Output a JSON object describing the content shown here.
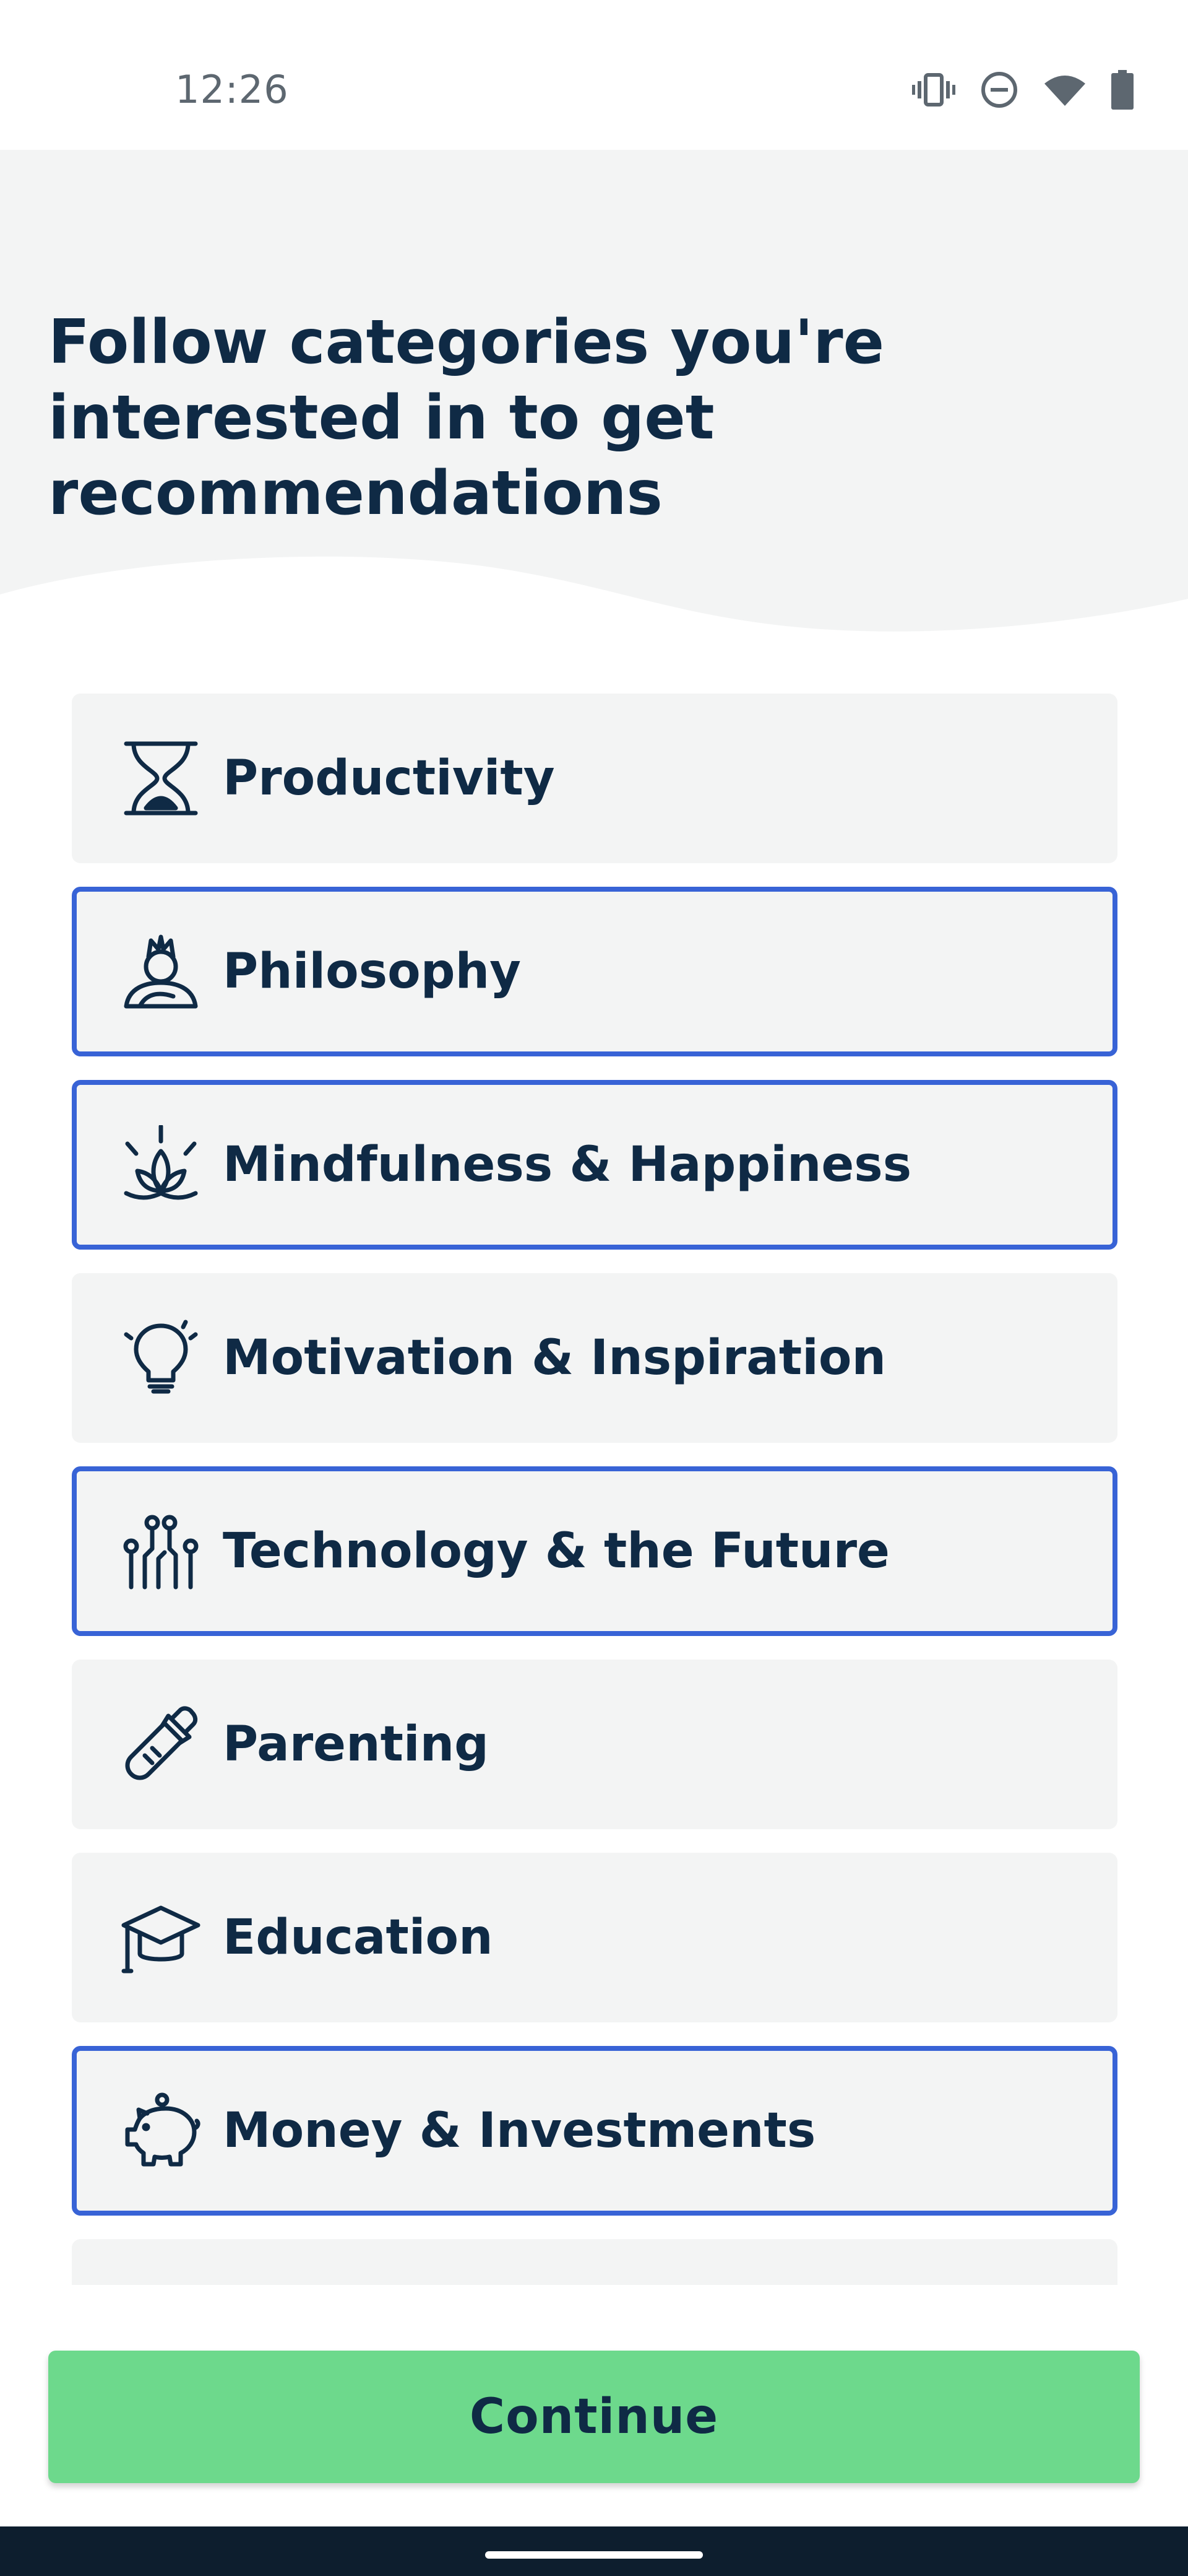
{
  "status_bar": {
    "time": "12:26",
    "icons": [
      "vibrate-icon",
      "do-not-disturb-icon",
      "wifi-icon",
      "battery-icon"
    ]
  },
  "header": {
    "title": "Follow categories you're interested in to get recommendations"
  },
  "categories": [
    {
      "label": "Productivity",
      "icon": "hourglass-icon",
      "selected": false
    },
    {
      "label": "Philosophy",
      "icon": "thinker-icon",
      "selected": true
    },
    {
      "label": "Mindfulness & Happiness",
      "icon": "lotus-icon",
      "selected": true
    },
    {
      "label": "Motivation & Inspiration",
      "icon": "lightbulb-icon",
      "selected": false
    },
    {
      "label": "Technology & the Future",
      "icon": "circuit-icon",
      "selected": true
    },
    {
      "label": "Parenting",
      "icon": "baby-bottle-icon",
      "selected": false
    },
    {
      "label": "Education",
      "icon": "graduation-cap-icon",
      "selected": false
    },
    {
      "label": "Money & Investments",
      "icon": "piggy-bank-icon",
      "selected": true
    }
  ],
  "continue_button": {
    "label": "Continue"
  },
  "colors": {
    "text": "#0f2a45",
    "card_bg": "#f3f4f4",
    "selected_border": "#3863d6",
    "button_bg": "#6dd98c",
    "header_bg": "#f3f4f4",
    "nav_bar": "#0d1e2e"
  }
}
